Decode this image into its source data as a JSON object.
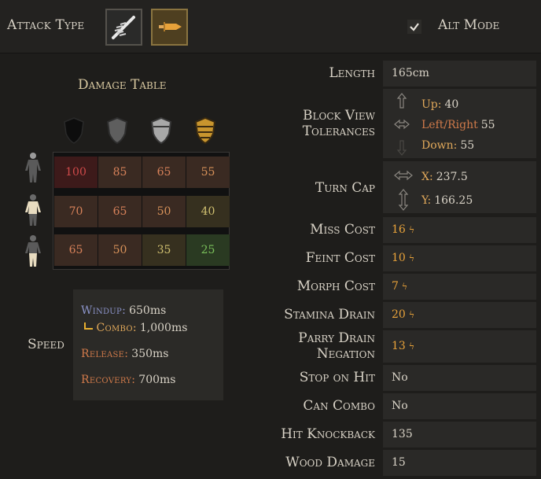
{
  "top": {
    "attack_type_label": "Attack Type",
    "alt_mode_label": "Alt Mode",
    "alt_mode_checked": true
  },
  "damage_table": {
    "title": "Damage Table",
    "armor_columns": [
      "none-armor-icon",
      "light-armor-icon",
      "medium-armor-icon",
      "heavy-armor-icon"
    ],
    "rows": [
      {
        "body_part": "head-icon",
        "values": [
          "100",
          "85",
          "65",
          "55"
        ]
      },
      {
        "body_part": "torso-icon",
        "values": [
          "70",
          "65",
          "50",
          "40"
        ]
      },
      {
        "body_part": "legs-icon",
        "values": [
          "65",
          "50",
          "35",
          "25"
        ]
      }
    ]
  },
  "speed": {
    "label": "Speed",
    "windup_key": "Windup:",
    "windup_val": "650ms",
    "combo_key": "Combo:",
    "combo_val": "1,000ms",
    "release_key": "Release:",
    "release_val": "350ms",
    "recovery_key": "Recovery:",
    "recovery_val": "700ms"
  },
  "stats": {
    "length_label": "Length",
    "length_val": "165cm",
    "block_label_1": "Block View",
    "block_label_2": "Tolerances",
    "block_up_key": "Up:",
    "block_up_val": "40",
    "block_lr_key": "Left/Right",
    "block_lr_val": "55",
    "block_down_key": "Down:",
    "block_down_val": "55",
    "turncap_label": "Turn Cap",
    "turncap_x_key": "X:",
    "turncap_x_val": "237.5",
    "turncap_y_key": "Y:",
    "turncap_y_val": "166.25",
    "miss_label": "Miss Cost",
    "miss_val": "16",
    "feint_label": "Feint Cost",
    "feint_val": "10",
    "morph_label": "Morph Cost",
    "morph_val": "7",
    "stamina_label": "Stamina Drain",
    "stamina_val": "20",
    "parry_label_1": "Parry Drain",
    "parry_label_2": "Negation",
    "parry_val": "13",
    "stop_label": "Stop on Hit",
    "stop_val": "No",
    "combo_label": "Can Combo",
    "combo_val": "No",
    "knock_label": "Hit Knockback",
    "knock_val": "135",
    "wood_label": "Wood Damage",
    "wood_val": "15"
  },
  "colors": {
    "accent_orange": "#e8a23a",
    "windup_blue": "#8b93c8",
    "release_orange": "#d07a4a",
    "combo_gold": "#e0a85a"
  }
}
